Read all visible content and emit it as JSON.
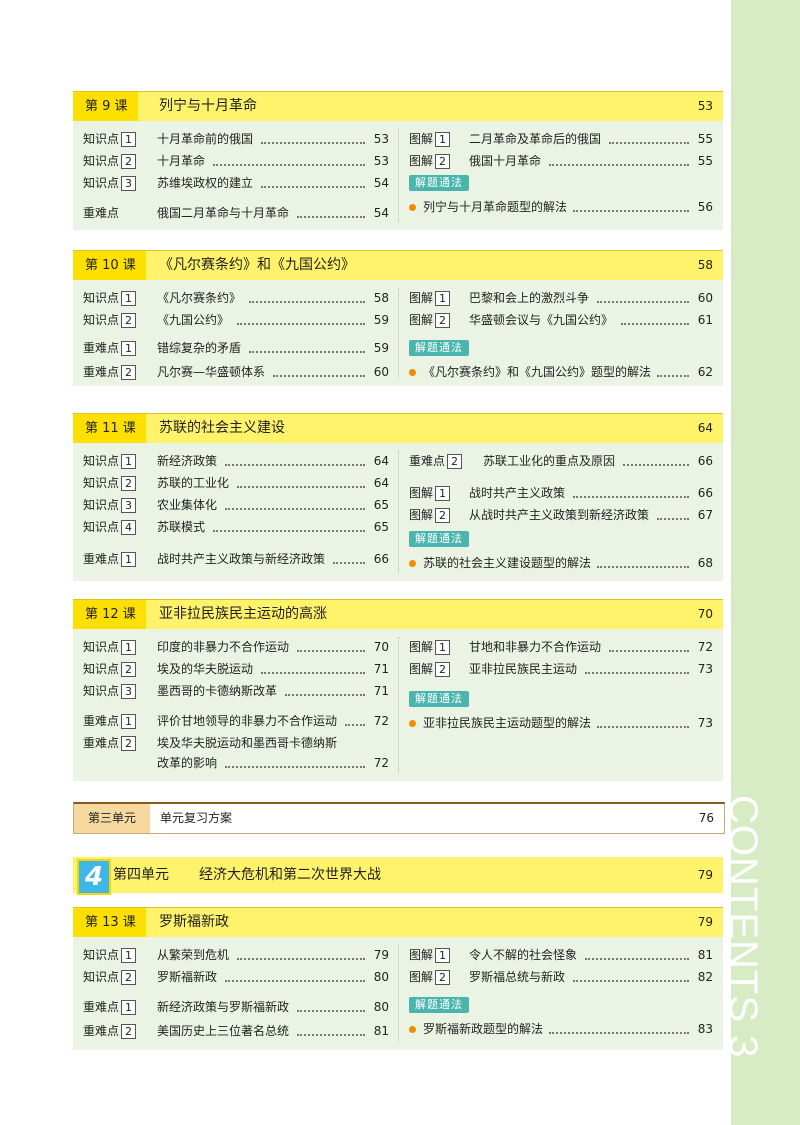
{
  "side_label": "CONTENTS 3",
  "method_label": "解题通法",
  "lesson9": {
    "badge": "第 9 课",
    "title": "列宁与十月革命",
    "page": "53",
    "left": [
      {
        "tag": "知识点",
        "num": "1",
        "text": "十月革命前的俄国",
        "page": "53"
      },
      {
        "tag": "知识点",
        "num": "2",
        "text": "十月革命",
        "page": "53"
      },
      {
        "tag": "知识点",
        "num": "3",
        "text": "苏维埃政权的建立",
        "page": "54"
      },
      {
        "tag": "重难点",
        "num": "",
        "text": "俄国二月革命与十月革命",
        "page": "54"
      }
    ],
    "right": [
      {
        "tag": "图解",
        "num": "1",
        "text": "二月革命及革命后的俄国",
        "page": "55"
      },
      {
        "tag": "图解",
        "num": "2",
        "text": "俄国十月革命",
        "page": "55"
      }
    ],
    "method_item": {
      "text": "列宁与十月革命题型的解法",
      "page": "56"
    }
  },
  "lesson10": {
    "badge": "第 10 课",
    "title": "《凡尔赛条约》和《九国公约》",
    "page": "58",
    "left": [
      {
        "tag": "知识点",
        "num": "1",
        "text": "《凡尔赛条约》",
        "page": "58"
      },
      {
        "tag": "知识点",
        "num": "2",
        "text": "《九国公约》",
        "page": "59"
      },
      {
        "tag": "重难点",
        "num": "1",
        "text": "错综复杂的矛盾",
        "page": "59"
      },
      {
        "tag": "重难点",
        "num": "2",
        "text": "凡尔赛—华盛顿体系",
        "page": "60"
      }
    ],
    "right": [
      {
        "tag": "图解",
        "num": "1",
        "text": "巴黎和会上的激烈斗争",
        "page": "60"
      },
      {
        "tag": "图解",
        "num": "2",
        "text": "华盛顿会议与《九国公约》",
        "page": "61"
      }
    ],
    "method_item": {
      "text": "《凡尔赛条约》和《九国公约》题型的解法",
      "page": "62"
    }
  },
  "lesson11": {
    "badge": "第 11 课",
    "title": "苏联的社会主义建设",
    "page": "64",
    "left": [
      {
        "tag": "知识点",
        "num": "1",
        "text": "新经济政策",
        "page": "64"
      },
      {
        "tag": "知识点",
        "num": "2",
        "text": "苏联的工业化",
        "page": "64"
      },
      {
        "tag": "知识点",
        "num": "3",
        "text": "农业集体化",
        "page": "65"
      },
      {
        "tag": "知识点",
        "num": "4",
        "text": "苏联模式",
        "page": "65"
      },
      {
        "tag": "重难点",
        "num": "1",
        "text": "战时共产主义政策与新经济政策",
        "page": "66"
      }
    ],
    "right": [
      {
        "tag": "重难点",
        "num": "2",
        "text": "苏联工业化的重点及原因",
        "page": "66"
      },
      {
        "tag": "图解",
        "num": "1",
        "text": "战时共产主义政策",
        "page": "66"
      },
      {
        "tag": "图解",
        "num": "2",
        "text": "从战时共产主义政策到新经济政策",
        "page": "67"
      }
    ],
    "method_item": {
      "text": "苏联的社会主义建设题型的解法",
      "page": "68"
    }
  },
  "lesson12": {
    "badge": "第 12 课",
    "title": "亚非拉民族民主运动的高涨",
    "page": "70",
    "left": [
      {
        "tag": "知识点",
        "num": "1",
        "text": "印度的非暴力不合作运动",
        "page": "70"
      },
      {
        "tag": "知识点",
        "num": "2",
        "text": "埃及的华夫脱运动",
        "page": "71"
      },
      {
        "tag": "知识点",
        "num": "3",
        "text": "墨西哥的卡德纳斯改革",
        "page": "71"
      },
      {
        "tag": "重难点",
        "num": "1",
        "text": "评价甘地领导的非暴力不合作运动",
        "page": "72"
      },
      {
        "tag": "重难点",
        "num": "2",
        "text": "埃及华夫脱运动和墨西哥卡德纳斯",
        "page": ""
      },
      {
        "tag": "",
        "num": "",
        "text": "改革的影响",
        "page": "72"
      }
    ],
    "right": [
      {
        "tag": "图解",
        "num": "1",
        "text": "甘地和非暴力不合作运动",
        "page": "72"
      },
      {
        "tag": "图解",
        "num": "2",
        "text": "亚非拉民族民主运动",
        "page": "73"
      }
    ],
    "method_item": {
      "text": "亚非拉民族民主运动题型的解法",
      "page": "73"
    }
  },
  "unit3": {
    "badge": "第三单元",
    "title": "单元复习方案",
    "page": "76"
  },
  "unit4": {
    "num": "4",
    "label": "第四单元",
    "title": "经济大危机和第二次世界大战",
    "page": "79"
  },
  "lesson13": {
    "badge": "第 13 课",
    "title": "罗斯福新政",
    "page": "79",
    "left": [
      {
        "tag": "知识点",
        "num": "1",
        "text": "从繁荣到危机",
        "page": "79"
      },
      {
        "tag": "知识点",
        "num": "2",
        "text": "罗斯福新政",
        "page": "80"
      },
      {
        "tag": "重难点",
        "num": "1",
        "text": "新经济政策与罗斯福新政",
        "page": "80"
      },
      {
        "tag": "重难点",
        "num": "2",
        "text": "美国历史上三位著名总统",
        "page": "81"
      }
    ],
    "right": [
      {
        "tag": "图解",
        "num": "1",
        "text": "令人不解的社会怪象",
        "page": "81"
      },
      {
        "tag": "图解",
        "num": "2",
        "text": "罗斯福总统与新政",
        "page": "82"
      }
    ],
    "method_item": {
      "text": "罗斯福新政题型的解法",
      "page": "83"
    }
  }
}
